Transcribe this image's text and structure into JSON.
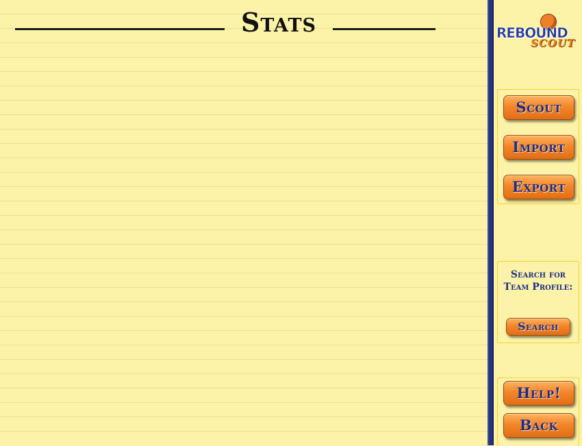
{
  "page": {
    "title": "Stats"
  },
  "logo": {
    "word1": "REBOUND",
    "word2": "SCOUT"
  },
  "nav": {
    "scout_label": "Scout",
    "import_label": "Import",
    "export_label": "Export"
  },
  "search": {
    "prompt_line1": "Search for",
    "prompt_line2": "Team Profile:",
    "button_label": "Search"
  },
  "footer": {
    "help_label": "Help!",
    "back_label": "Back"
  },
  "colors": {
    "paper": "#fdf3a8",
    "divider": "#24357e",
    "button_orange": "#f3862c",
    "button_text": "#1c2f86",
    "panel_border": "#f5d32a"
  }
}
